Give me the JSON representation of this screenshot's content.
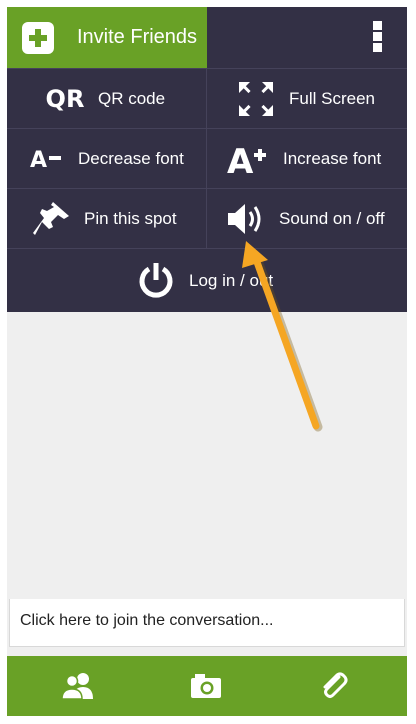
{
  "header": {
    "invite_label": "Invite Friends"
  },
  "menu": {
    "qr_label": "QR code",
    "qr_glyph": "QR",
    "fullscreen_label": "Full Screen",
    "decrease_label": "Decrease font",
    "increase_label": "Increase font",
    "pin_label": "Pin this spot",
    "sound_label": "Sound on / off",
    "login_label": "Log in / out"
  },
  "chat": {
    "placeholder": "Click here to join the conversation..."
  },
  "colors": {
    "green": "#69a126",
    "panel": "#333045",
    "arrow": "#f5a623"
  },
  "icons": [
    "plus-icon",
    "kebab-icon",
    "qr-icon",
    "fullscreen-icon",
    "decrease-font-icon",
    "increase-font-icon",
    "pin-icon",
    "speaker-icon",
    "power-icon",
    "users-icon",
    "camera-icon",
    "paperclip-icon"
  ]
}
